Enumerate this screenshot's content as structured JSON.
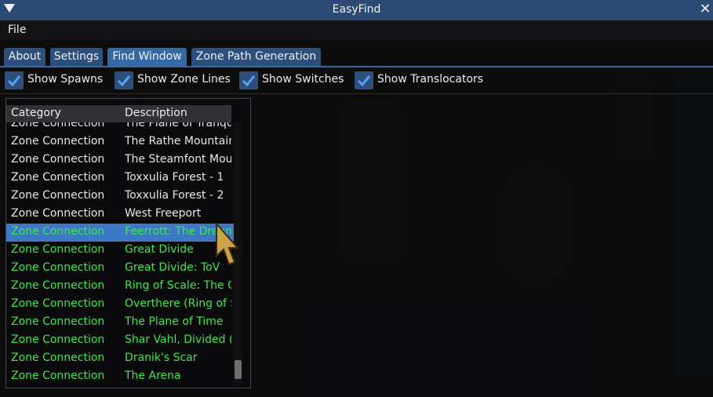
{
  "window": {
    "title": "EasyFind"
  },
  "menu": {
    "file": "File"
  },
  "tabs": [
    {
      "label": "About",
      "active": false
    },
    {
      "label": "Settings",
      "active": false
    },
    {
      "label": "Find Window",
      "active": true
    },
    {
      "label": "Zone Path Generation",
      "active": false
    }
  ],
  "filters": [
    {
      "label": "Show Spawns",
      "checked": true
    },
    {
      "label": "Show Zone Lines",
      "checked": true
    },
    {
      "label": "Show Switches",
      "checked": true
    },
    {
      "label": "Show Translocators",
      "checked": true
    }
  ],
  "table": {
    "headers": {
      "category": "Category",
      "description": "Description"
    },
    "rows": [
      {
        "category": "Zone Connection",
        "description": "The Plane of Tranquility",
        "color": "#e8e8e8",
        "partial": true
      },
      {
        "category": "Zone Connection",
        "description": "The Rathe Mountains",
        "color": "#e8e8e8"
      },
      {
        "category": "Zone Connection",
        "description": "The Steamfont Mountains",
        "color": "#e8e8e8"
      },
      {
        "category": "Zone Connection",
        "description": "Toxxulia Forest - 1",
        "color": "#e8e8e8"
      },
      {
        "category": "Zone Connection",
        "description": "Toxxulia Forest - 2",
        "color": "#e8e8e8"
      },
      {
        "category": "Zone Connection",
        "description": "West Freeport",
        "color": "#e8e8e8"
      },
      {
        "category": "Zone Connection",
        "description": "Feerrott: The Dream",
        "color": "#3ee84a",
        "selected": true
      },
      {
        "category": "Zone Connection",
        "description": "Great Divide",
        "color": "#3ee84a"
      },
      {
        "category": "Zone Connection",
        "description": "Great Divide: ToV",
        "color": "#3ee84a"
      },
      {
        "category": "Zone Connection",
        "description": "Ring of Scale: The Overthere",
        "color": "#3ee84a"
      },
      {
        "category": "Zone Connection",
        "description": "Overthere (Ring of Scale)",
        "color": "#3ee84a"
      },
      {
        "category": "Zone Connection",
        "description": "The Plane of Time",
        "color": "#3ee84a"
      },
      {
        "category": "Zone Connection",
        "description": "Shar Vahl, Divided (",
        "color": "#3ee84a"
      },
      {
        "category": "Zone Connection",
        "description": "Dranik's Scar",
        "color": "#3ee84a"
      },
      {
        "category": "Zone Connection",
        "description": "The Arena",
        "color": "#3ee84a"
      }
    ]
  },
  "colors": {
    "accent": "#3569a6",
    "tab": "#2d4f7c",
    "selected_row": "#3d78c4",
    "zone_green": "#3ee84a"
  }
}
